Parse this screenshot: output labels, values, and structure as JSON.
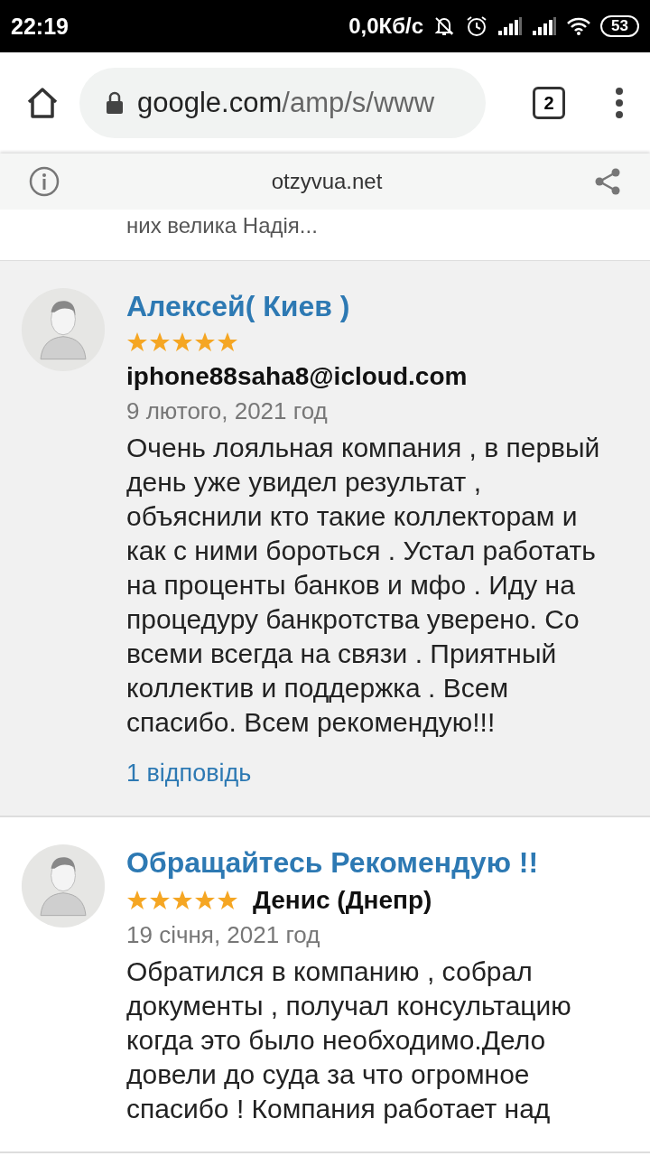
{
  "status_bar": {
    "time": "22:19",
    "network_speed": "0,0Кб/с",
    "battery": "53"
  },
  "browser": {
    "url_host": "google.com",
    "url_path": "/amp/s/www",
    "tab_count": "2"
  },
  "banner": {
    "domain": "otzyvua.net"
  },
  "previous_snippet": "них велика Надія...",
  "reviews": [
    {
      "title": "Алексей( Киев )",
      "stars": 5,
      "author": "iphone88saha8@icloud.com",
      "author_inline": false,
      "date": "9 лютого, 2021 год",
      "text": "Очень лояльная компания , в первый день уже увидел результат , объяснили кто такие коллекторам и как с ними бороться . Устал работать на проценты банков и мфо . Иду на процедуру банкротства уверено. Со всеми всегда на связи . Приятный коллектив и поддержка . Всем спасибо. Всем рекомендую!!!",
      "replies": "1 відповідь",
      "highlighted": true
    },
    {
      "title": "Обращайтесь Рекомендую !!",
      "stars": 5,
      "author": "Денис (Днепр)",
      "author_inline": true,
      "date": "19 січня, 2021 год",
      "text": "Обратился в компанию , собрал документы , получал консультацию когда это было необходимо.Дело довели до суда за что огромное спасибо ! Компания работает над",
      "highlighted": false
    }
  ]
}
